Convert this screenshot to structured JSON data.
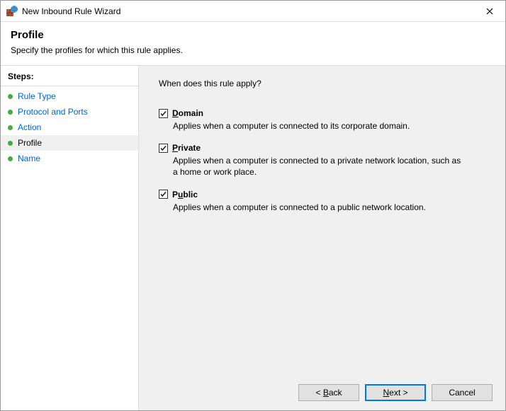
{
  "window": {
    "title": "New Inbound Rule Wizard"
  },
  "header": {
    "heading": "Profile",
    "subtitle": "Specify the profiles for which this rule applies."
  },
  "sidebar": {
    "steps_label": "Steps:",
    "items": [
      {
        "label": "Rule Type",
        "state": "link"
      },
      {
        "label": "Protocol and Ports",
        "state": "link"
      },
      {
        "label": "Action",
        "state": "link"
      },
      {
        "label": "Profile",
        "state": "current"
      },
      {
        "label": "Name",
        "state": "link"
      }
    ]
  },
  "main": {
    "question": "When does this rule apply?",
    "options": [
      {
        "key": "domain",
        "label_pre": "",
        "label_ul": "D",
        "label_post": "omain",
        "checked": true,
        "description": "Applies when a computer is connected to its corporate domain."
      },
      {
        "key": "private",
        "label_pre": "",
        "label_ul": "P",
        "label_post": "rivate",
        "checked": true,
        "description": "Applies when a computer is connected to a private network location, such as a home or work place."
      },
      {
        "key": "public",
        "label_pre": "P",
        "label_ul": "u",
        "label_post": "blic",
        "checked": true,
        "description": "Applies when a computer is connected to a public network location."
      }
    ]
  },
  "buttons": {
    "back_pre": "< ",
    "back_ul": "B",
    "back_post": "ack",
    "next_ul": "N",
    "next_post": "ext >",
    "cancel": "Cancel"
  }
}
